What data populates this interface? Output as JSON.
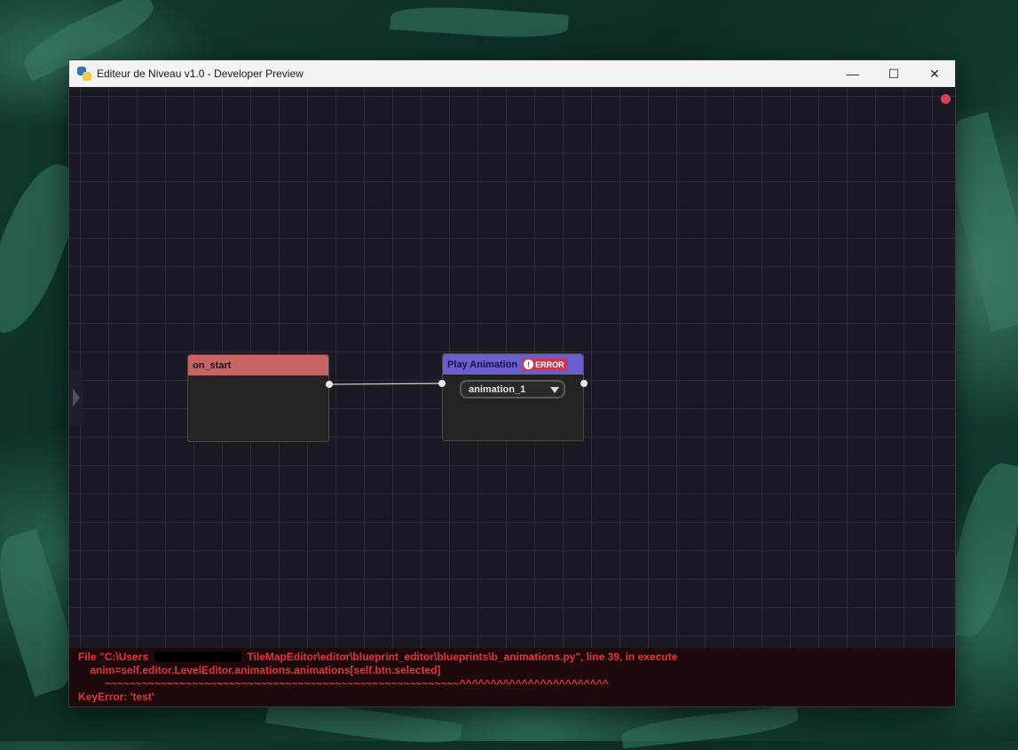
{
  "window": {
    "title": "Editeur de Niveau v1.0 - Developer Preview",
    "controls": {
      "minimize": "—",
      "maximize": "☐",
      "close": "✕"
    }
  },
  "nodes": {
    "on_start": {
      "title": "on_start"
    },
    "play_animation": {
      "title": "Play Animation",
      "badge": "ERROR",
      "badge_icon": "!",
      "dropdown_value": "animation_1"
    }
  },
  "console": {
    "line1_part1": "File \"C:\\Users",
    "line1_part2": "TileMapEditor\\editor\\blueprint_editor\\blueprints\\b_animations.py\", line 39, in execute",
    "line2": "    anim=self.editor.LevelEditor.animations.animations[self.btn.selected]",
    "line3": "         ~~~~~~~~~~~~~~~~~~~~~~~~~~~~~~~~~~~~~~~~~~~~~~~~~~~~~~~~~^^^^^^^^^^^^^^^^^^^^^^^^",
    "line4": "KeyError: 'test'"
  },
  "colors": {
    "on_start_header": "#c96464",
    "play_animation_header": "#6a5fcf",
    "error": "#c7394e",
    "console_text": "#e0333d",
    "canvas_bg": "#1b1a24"
  },
  "icons": {
    "app": "pygame-icon",
    "status": "record-dot-icon",
    "panel_toggle": "chevron-right-icon",
    "dropdown": "caret-down-icon"
  }
}
